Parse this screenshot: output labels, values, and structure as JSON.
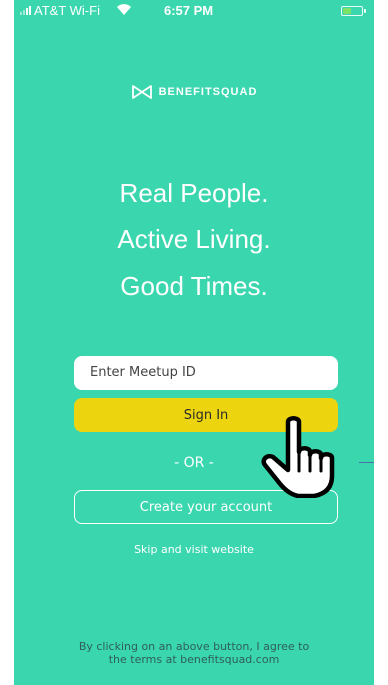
{
  "status_bar": {
    "carrier": "AT&T Wi-Fi",
    "time": "6:57 PM"
  },
  "logo": {
    "text": "BENEFITSQUAD"
  },
  "headline": {
    "line1": "Real People.",
    "line2": "Active Living.",
    "line3": "Good Times."
  },
  "form": {
    "meetup_placeholder": "Enter Meetup ID",
    "signin_label": "Sign In",
    "or_label": "- OR -",
    "create_account_label": "Create your account",
    "skip_label": "Skip and visit website"
  },
  "footer": {
    "terms_line1": "By clicking on an above button, I agree to",
    "terms_line2": "the terms at benefitsquad.com"
  },
  "colors": {
    "background": "#3ad6ae",
    "signin_button": "#ecd40f"
  }
}
